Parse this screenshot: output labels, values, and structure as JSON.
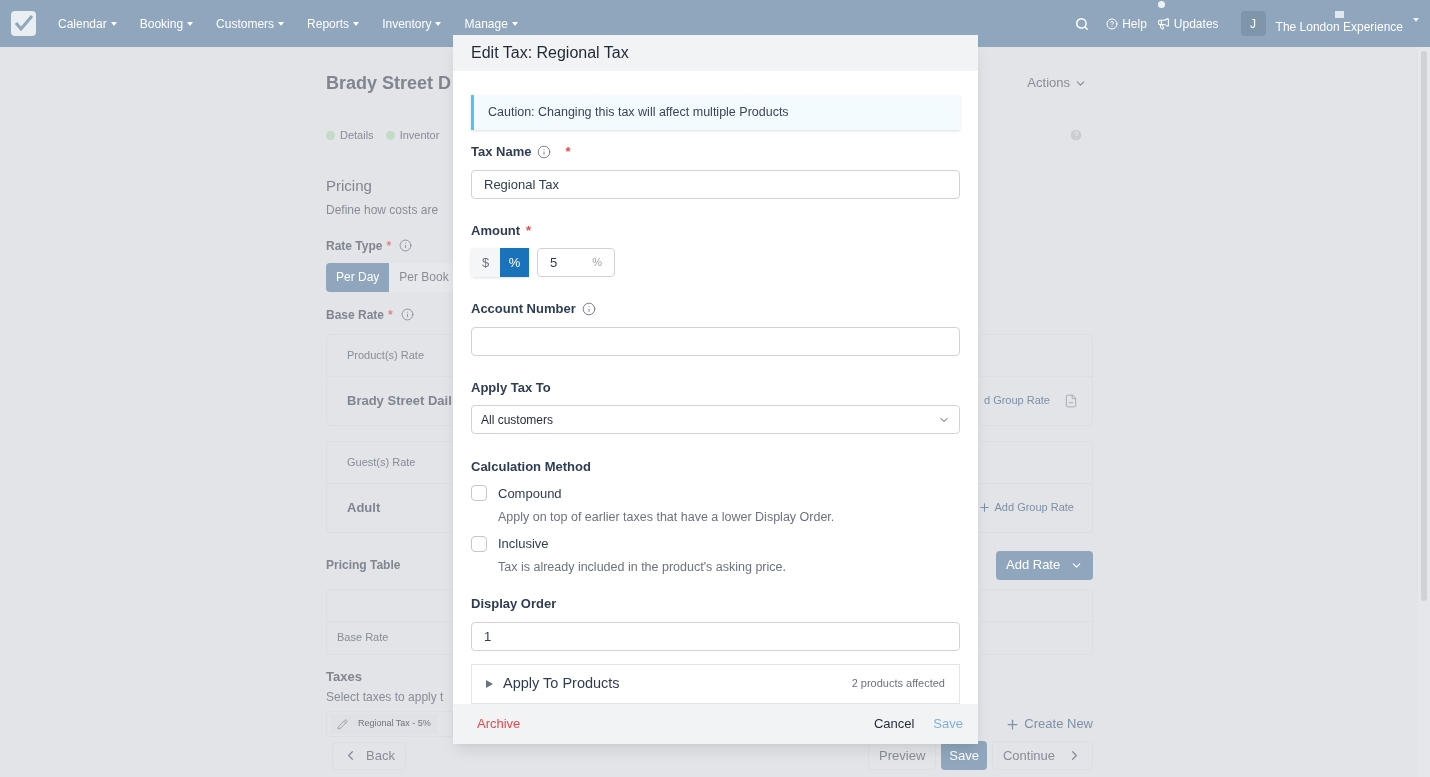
{
  "nav": {
    "items": [
      {
        "label": "Calendar"
      },
      {
        "label": "Booking"
      },
      {
        "label": "Customers"
      },
      {
        "label": "Reports"
      },
      {
        "label": "Inventory"
      },
      {
        "label": "Manage"
      }
    ],
    "help": "Help",
    "updates": "Updates",
    "updates_unread": true,
    "avatar": "J",
    "account": "The London Experience"
  },
  "page": {
    "title": "Brady Street D",
    "actions": "Actions",
    "steps": [
      {
        "label": "Details",
        "completed": true
      },
      {
        "label": "Inventor",
        "completed": true
      }
    ],
    "section_title": "Pricing",
    "section_subtitle": "Define how costs are",
    "rate_type": {
      "label": "Rate Type",
      "required_mark": "*",
      "tabs": [
        {
          "label": "Per Day",
          "selected": true
        },
        {
          "label": "Per Book",
          "selected": false
        }
      ]
    },
    "base_rate": {
      "label": "Base Rate",
      "required_mark": "*"
    },
    "product_rate": {
      "header": "Product(s) Rate",
      "row": "Brady Street Dail",
      "action": "d Group Rate"
    },
    "guest_rate": {
      "header": "Guest(s) Rate",
      "row": "Adult",
      "action": "Add Group Rate"
    },
    "pricing_table": {
      "label": "Pricing Table",
      "add_rate": "Add Rate",
      "row": "Base Rate"
    },
    "taxes": {
      "label": "Taxes",
      "hint": "Select taxes to apply t",
      "chip": "Regional Tax - 5%",
      "create_new": "Create New"
    },
    "footer": {
      "back": "Back",
      "preview": "Preview",
      "save": "Save",
      "continue": "Continue"
    }
  },
  "modal": {
    "title": "Edit Tax: Regional Tax",
    "caution": "Caution: Changing this tax will affect multiple Products",
    "tax_name": {
      "label": "Tax Name",
      "info": true,
      "required_mark": "*",
      "value": "Regional Tax"
    },
    "amount": {
      "label": "Amount",
      "required_mark": "*",
      "units": [
        {
          "label": "$",
          "selected": false
        },
        {
          "label": "%",
          "selected": true
        }
      ],
      "value": "5",
      "suffix": "%"
    },
    "account_number": {
      "label": "Account Number",
      "info": true
    },
    "apply_to": {
      "label": "Apply Tax To",
      "value": "All customers"
    },
    "calculation": {
      "label": "Calculation Method",
      "options": [
        {
          "label": "Compound",
          "description": "Apply on top of earlier taxes that have a lower Display Order.",
          "checked": false
        },
        {
          "label": "Inclusive",
          "description": "Tax is already included in the product's asking price.",
          "checked": false
        }
      ]
    },
    "display_order": {
      "label": "Display Order",
      "value": "1"
    },
    "products": {
      "label": "Apply To Products",
      "count": "2 products affected",
      "expanded": false
    },
    "archive": "Archive",
    "cancel": "Cancel",
    "save": {
      "label": "Save",
      "disabled": true
    }
  }
}
